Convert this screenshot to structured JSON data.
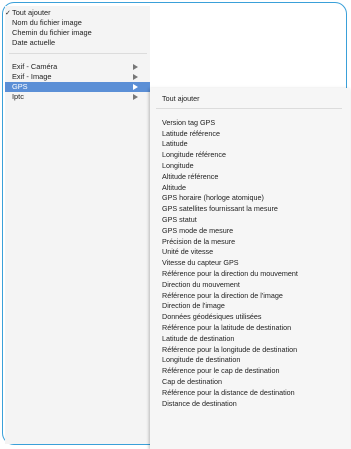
{
  "main_menu": {
    "items": [
      {
        "label": "Tout ajouter",
        "checked": true
      },
      {
        "label": "Nom du fichier image"
      },
      {
        "label": "Chemin du fichier image"
      },
      {
        "label": "Date actuelle"
      },
      {
        "label": "Exif - Caméra",
        "has_submenu": true
      },
      {
        "label": "Exif - Image",
        "has_submenu": true
      },
      {
        "label": "GPS",
        "has_submenu": true,
        "selected": true
      },
      {
        "label": "Iptc",
        "has_submenu": true
      }
    ]
  },
  "gps_submenu": {
    "items": [
      "Tout ajouter",
      "Version tag GPS",
      "Latitude référence",
      "Latitude",
      "Longitude référence",
      "Longitude",
      "Altitude référence",
      "Altitude",
      "GPS horaire (horloge atomique)",
      "GPS satellites fournissant la mesure",
      "GPS statut",
      "GPS mode de mesure",
      "Précision de la mesure",
      "Unité de vitesse",
      "Vitesse du capteur GPS",
      "Référence pour la direction du mouvement",
      "Direction du mouvement",
      "Référence pour la direction de l'image",
      "Direction de l'image",
      "Données géodésiques utilisées",
      "Référence pour la latitude de destination",
      "Latitude de destination",
      "Référence pour la longitude de destination",
      "Longitude de destination",
      "Référence pour le cap de destination",
      "Cap de destination",
      "Référence pour la distance de destination",
      "Distance de destination"
    ]
  },
  "colors": {
    "highlight": "#5b8fd6",
    "frame_border": "#3aa0d9",
    "menu_bg": "#f4f4f4"
  }
}
